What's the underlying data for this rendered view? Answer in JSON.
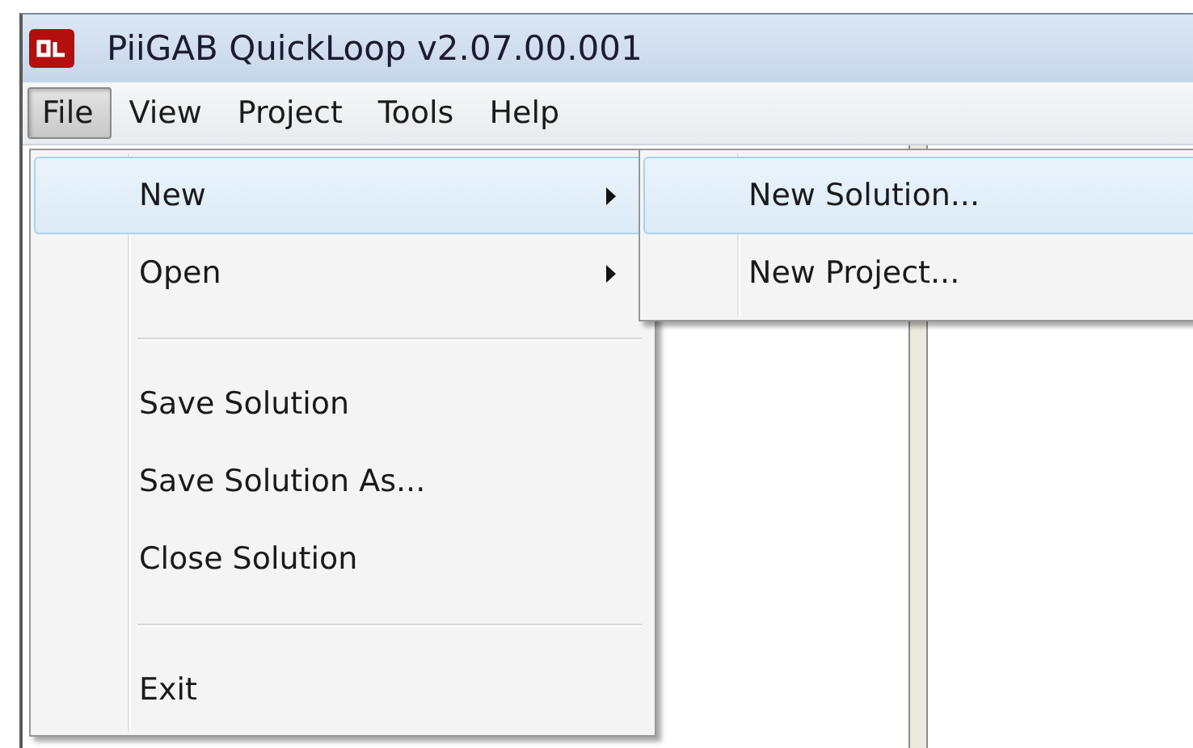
{
  "window": {
    "title": "PiiGAB QuickLoop v2.07.00.001"
  },
  "menu_bar": [
    {
      "label": "File",
      "selected": true
    },
    {
      "label": "View",
      "selected": false
    },
    {
      "label": "Project",
      "selected": false
    },
    {
      "label": "Tools",
      "selected": false
    },
    {
      "label": "Help",
      "selected": false
    }
  ],
  "file_menu": [
    {
      "kind": "item",
      "label": "New",
      "highlighted": true,
      "has_submenu": true
    },
    {
      "kind": "item",
      "label": "Open",
      "highlighted": false,
      "has_submenu": true
    },
    {
      "kind": "separator"
    },
    {
      "kind": "item",
      "label": "Save Solution",
      "highlighted": false,
      "has_submenu": false
    },
    {
      "kind": "item",
      "label": "Save Solution As...",
      "highlighted": false,
      "has_submenu": false
    },
    {
      "kind": "item",
      "label": "Close Solution",
      "highlighted": false,
      "has_submenu": false
    },
    {
      "kind": "separator"
    },
    {
      "kind": "item",
      "label": "Exit",
      "highlighted": false,
      "has_submenu": false
    }
  ],
  "new_submenu": [
    {
      "kind": "item",
      "label": "New Solution...",
      "highlighted": true,
      "has_submenu": false
    },
    {
      "kind": "item",
      "label": "New Project...",
      "highlighted": false,
      "has_submenu": false
    }
  ]
}
